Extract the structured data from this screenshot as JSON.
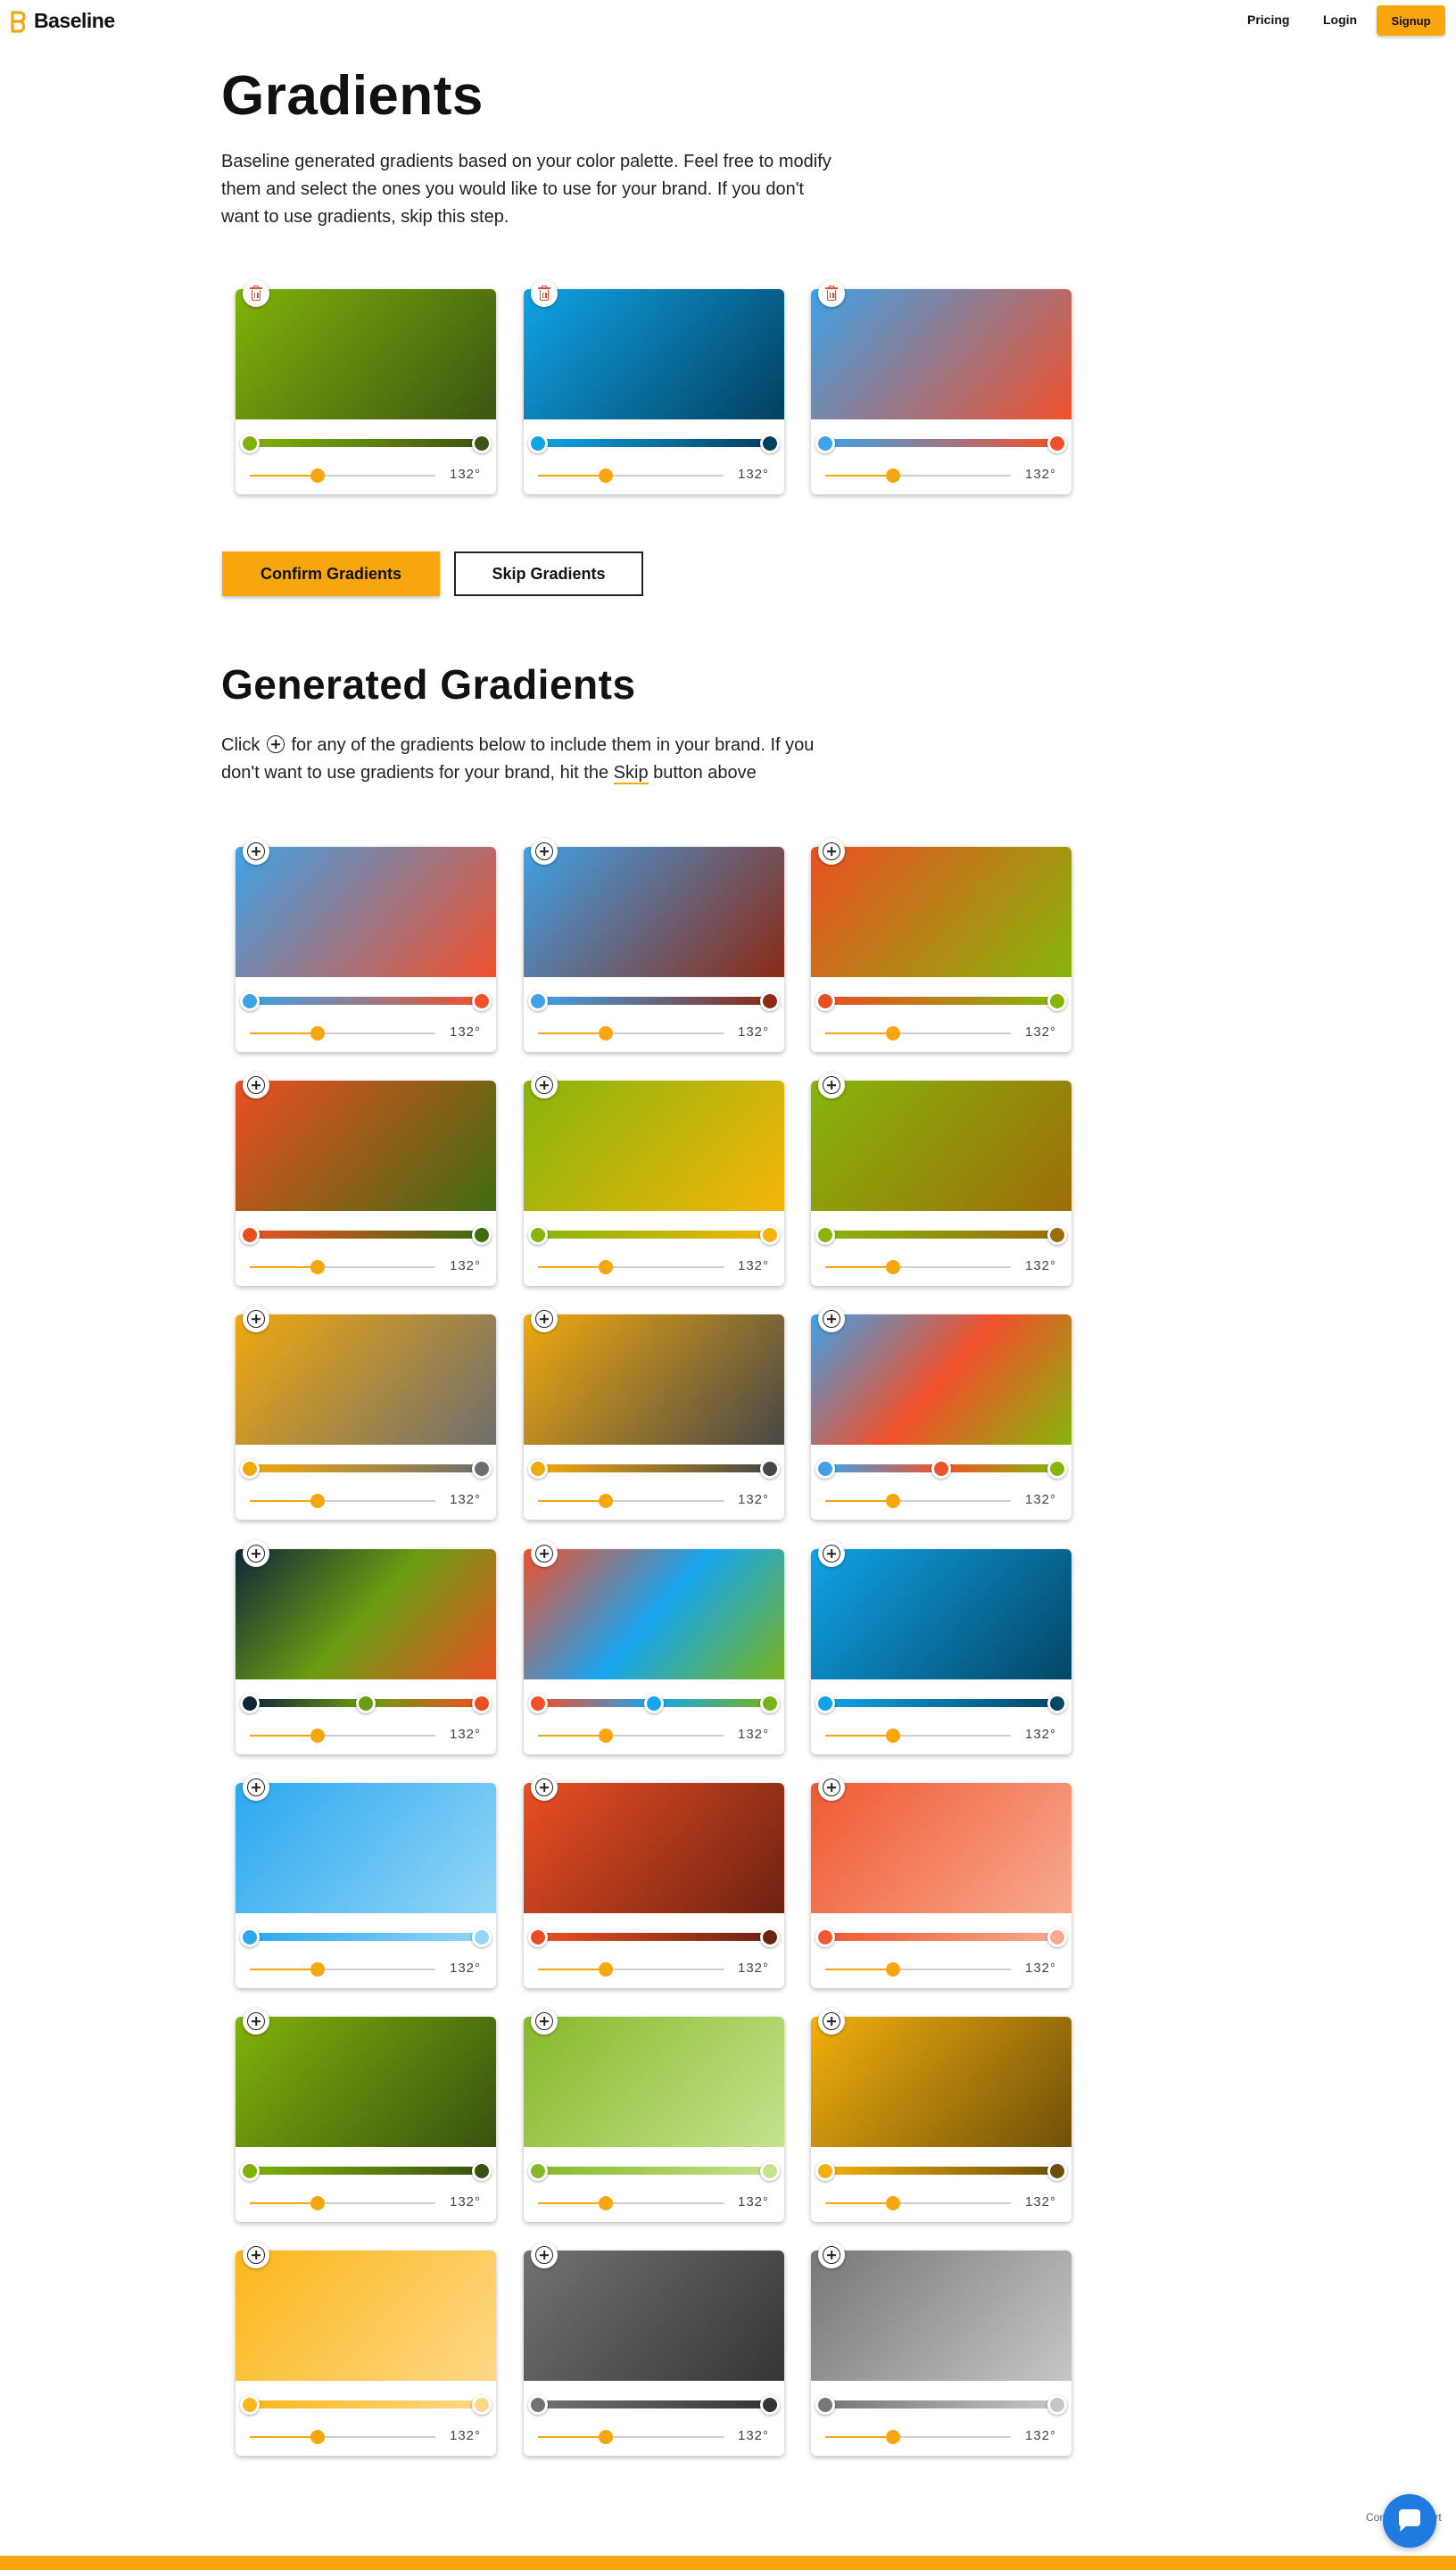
{
  "nav": {
    "brand": "Baseline",
    "pricing": "Pricing",
    "login": "Login",
    "signup": "Signup"
  },
  "colors": {
    "accent": "#f7a70d",
    "delete": "#e14b3b",
    "chat": "#1f7be0"
  },
  "selected_section": {
    "title": "Gradients",
    "description": "Baseline generated gradients based on your color palette. Feel free to modify them and select the ones you would like to use for your brand. If you don't want to use gradients, skip this step.",
    "confirm_label": "Confirm Gradients",
    "skip_label": "Skip Gradients",
    "card_action_icon": "trash-icon",
    "gradients": [
      {
        "stops": [
          "#80b20a",
          "#3c5512"
        ],
        "angle": "132°"
      },
      {
        "stops": [
          "#10a3e6",
          "#02405f"
        ],
        "angle": "132°"
      },
      {
        "stops": [
          "#3fa1e6",
          "#f0512b"
        ],
        "angle": "132°"
      }
    ]
  },
  "generated_section": {
    "title": "Generated Gradients",
    "description_pre": "Click",
    "description_mid": "for any of the gradients below to include them in your brand. If you don't want to use gradients for your brand, hit the",
    "skip_word": "Skip",
    "description_post": "button above",
    "card_action_icon": "plus-circle-icon",
    "gradients": [
      {
        "stops": [
          "#3fa1e6",
          "#f0512b"
        ],
        "angle": "132°"
      },
      {
        "stops": [
          "#3fa1e6",
          "#8c2a14"
        ],
        "angle": "132°"
      },
      {
        "stops": [
          "#ea4f23",
          "#86b50c"
        ],
        "angle": "132°"
      },
      {
        "stops": [
          "#ea4f23",
          "#3f6c10"
        ],
        "angle": "132°"
      },
      {
        "stops": [
          "#86b50c",
          "#f5b50a"
        ],
        "angle": "132°"
      },
      {
        "stops": [
          "#86b50c",
          "#9d6d0a"
        ],
        "angle": "132°"
      },
      {
        "stops": [
          "#f0a90f",
          "#6e6e6e"
        ],
        "angle": "132°"
      },
      {
        "stops": [
          "#f0a90f",
          "#474747"
        ],
        "angle": "132°"
      },
      {
        "stops": [
          "#3fa1e6",
          "#f0512b",
          "#86b50c"
        ],
        "angle": "132°"
      },
      {
        "stops": [
          "#0f2637",
          "#6a9d12",
          "#ea4f23"
        ],
        "angle": "132°"
      },
      {
        "stops": [
          "#f0512b",
          "#18a5ef",
          "#78b31c"
        ],
        "angle": "132°"
      },
      {
        "stops": [
          "#10a3e6",
          "#034666"
        ],
        "angle": "132°"
      },
      {
        "stops": [
          "#2ba8ef",
          "#93d6f7"
        ],
        "angle": "132°"
      },
      {
        "stops": [
          "#ea4f23",
          "#6e2212"
        ],
        "angle": "132°"
      },
      {
        "stops": [
          "#f05a32",
          "#f7a98f"
        ],
        "angle": "132°"
      },
      {
        "stops": [
          "#80b20a",
          "#395210"
        ],
        "angle": "132°"
      },
      {
        "stops": [
          "#86b92a",
          "#c5e28d"
        ],
        "angle": "132°"
      },
      {
        "stops": [
          "#f2b00d",
          "#6f4f0a"
        ],
        "angle": "132°"
      },
      {
        "stops": [
          "#fbb71b",
          "#fed886"
        ],
        "angle": "132°"
      },
      {
        "stops": [
          "#727272",
          "#353535"
        ],
        "angle": "132°"
      },
      {
        "stops": [
          "#777777",
          "#c6c6c6"
        ],
        "angle": "132°"
      }
    ]
  },
  "chat": {
    "text": "Contact support",
    "icon": "chat-bubble-icon"
  }
}
